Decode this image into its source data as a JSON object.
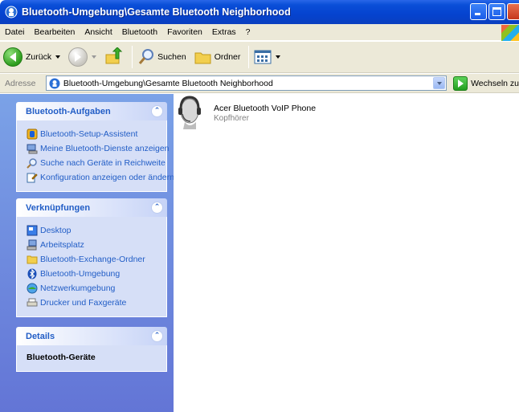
{
  "window": {
    "title": "Bluetooth-Umgebung\\Gesamte Bluetooth Neighborhood"
  },
  "menu": [
    "Datei",
    "Bearbeiten",
    "Ansicht",
    "Bluetooth",
    "Favoriten",
    "Extras",
    "?"
  ],
  "toolbar": {
    "back_label": "Zurück",
    "search_label": "Suchen",
    "folders_label": "Ordner"
  },
  "address": {
    "label": "Adresse",
    "value": "Bluetooth-Umgebung\\Gesamte Bluetooth Neighborhood",
    "go_label": "Wechseln zu"
  },
  "sidebar": {
    "tasks": {
      "title": "Bluetooth-Aufgaben",
      "items": [
        {
          "label": "Bluetooth-Setup-Assistent",
          "icon": "setup-wizard-icon"
        },
        {
          "label": "Meine Bluetooth-Dienste anzeigen",
          "icon": "services-icon"
        },
        {
          "label": "Suche nach Geräte in Reichweite",
          "icon": "search-icon"
        },
        {
          "label": "Konfiguration anzeigen oder ändern",
          "icon": "configuration-icon"
        }
      ]
    },
    "links": {
      "title": "Verknüpfungen",
      "items": [
        {
          "label": "Desktop",
          "icon": "desktop-icon"
        },
        {
          "label": "Arbeitsplatz",
          "icon": "my-computer-icon"
        },
        {
          "label": "Bluetooth-Exchange-Ordner",
          "icon": "folder-icon"
        },
        {
          "label": "Bluetooth-Umgebung",
          "icon": "bluetooth-icon"
        },
        {
          "label": "Netzwerkumgebung",
          "icon": "network-icon"
        },
        {
          "label": "Drucker und Faxgeräte",
          "icon": "printer-icon"
        }
      ]
    },
    "details": {
      "title": "Details",
      "heading": "Bluetooth-Geräte"
    }
  },
  "content": {
    "items": [
      {
        "name": "Acer Bluetooth VoIP Phone",
        "type": "Kopfhörer",
        "icon": "headset-icon"
      }
    ]
  }
}
